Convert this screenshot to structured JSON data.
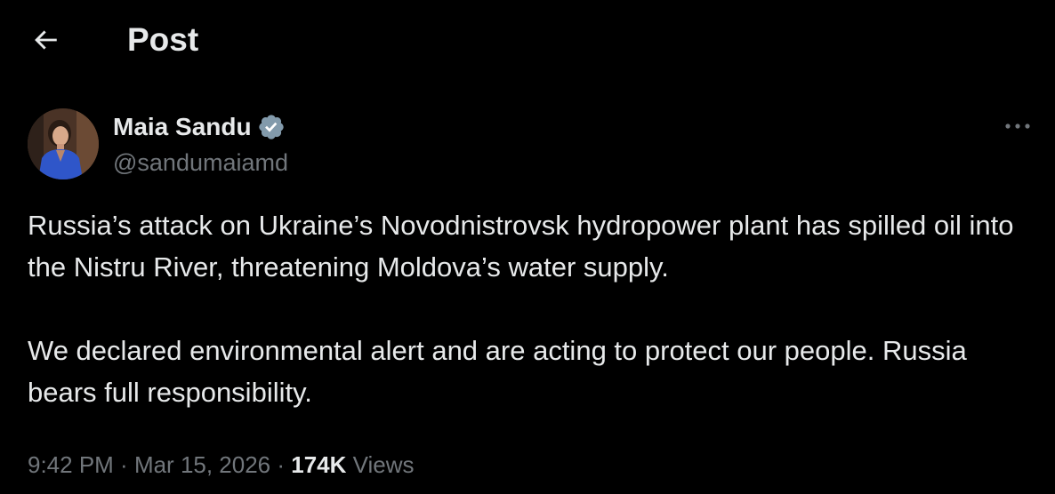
{
  "header": {
    "title": "Post",
    "back_icon": "arrow-left-icon"
  },
  "author": {
    "name": "Maia Sandu",
    "handle": "@sandumaiamd",
    "verified": true,
    "verified_icon": "verified-badge-icon",
    "avatar": "avatar-photo"
  },
  "more_icon": "more-horizontal-icon",
  "post": {
    "paragraphs": [
      "Russia’s attack on Ukraine’s Novodnistrovsk hydropower plant has spilled oil into the Nistru River, threatening Moldova’s water supply.",
      "We declared environmental alert and are acting to protect our people. Russia bears full responsibility."
    ]
  },
  "meta": {
    "time": "9:42 PM",
    "separator": " · ",
    "date": "Mar 15, 2026",
    "views_count": "174K",
    "views_label": "Views"
  },
  "colors": {
    "background": "#000000",
    "text_primary": "#e7e9ea",
    "text_secondary": "#71767b",
    "verified_blue": "#1d9bf0"
  }
}
